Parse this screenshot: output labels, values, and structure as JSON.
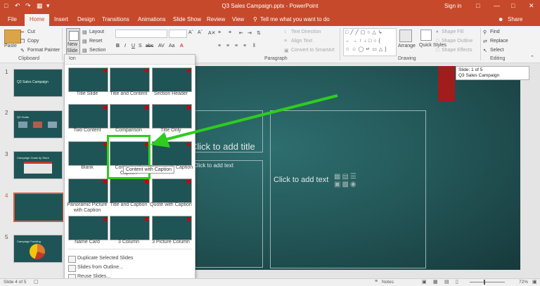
{
  "window": {
    "title": "Q3 Sales Campaign.pptx - PowerPoint",
    "signin": "Sign in",
    "share": "Share"
  },
  "tabs": [
    "File",
    "Home",
    "Insert",
    "Design",
    "Transitions",
    "Animations",
    "Slide Show",
    "Review",
    "View"
  ],
  "tellme": "Tell me what you want to do",
  "clipboard": {
    "paste": "Paste",
    "cut": "Cut",
    "copy": "Copy",
    "format_painter": "Format Painter",
    "group": "Clipboard"
  },
  "slides_group": {
    "new": "New",
    "slide": "Slide",
    "layout": "Layout",
    "reset": "Reset",
    "section": "Section"
  },
  "paragraph": {
    "text_direction": "Text Direction",
    "align_text": "Align Text",
    "convert_smartart": "Convert to SmartArt",
    "group": "Paragraph"
  },
  "drawing": {
    "arrange": "Arrange",
    "quick_styles": "Quick Styles",
    "shape_fill": "Shape Fill",
    "shape_outline": "Shape Outline",
    "shape_effects": "Shape Effects",
    "group": "Drawing"
  },
  "editing": {
    "find": "Find",
    "replace": "Replace",
    "select": "Select",
    "group": "Editing"
  },
  "slide_pane": {
    "numbers": [
      "1",
      "2",
      "3",
      "4",
      "5"
    ],
    "thumb1_title": "Q3 Sales Campaign",
    "thumb2_title": "Q3 Goals",
    "thumb3_title": "Campaign Goals by Store",
    "thumb5_title": "Campaign Funding"
  },
  "dropdown": {
    "header": "Ion",
    "layouts": [
      "Title Slide",
      "Title and Content",
      "Section Header",
      "Two Content",
      "Comparison",
      "Title Only",
      "Blank",
      "Content with Caption",
      "Picture with Caption",
      "Panoramic Picture with Caption",
      "Title and Caption",
      "Quote with Caption",
      "Name Card",
      "3 Column",
      "3 Picture Column"
    ],
    "tooltip": "Content with Caption",
    "duplicate": "Duplicate Selected Slides",
    "from_outline": "Slides from Outline...",
    "reuse": "Reuse Slides..."
  },
  "slide": {
    "title_placeholder": "Click to add title",
    "text_placeholder": "Click to add text",
    "text_left": "Click to add text"
  },
  "infobox": {
    "line1": "Slide: 1 of 5",
    "line2": "Q3 Sales Campaign"
  },
  "status": {
    "slide_count": "Slide 4 of 5",
    "notes": "Notes",
    "zoom": "72%"
  },
  "colors": {
    "accent": "#c6492b",
    "slide_bg": "#235657",
    "highlight": "#2ecc1f"
  }
}
